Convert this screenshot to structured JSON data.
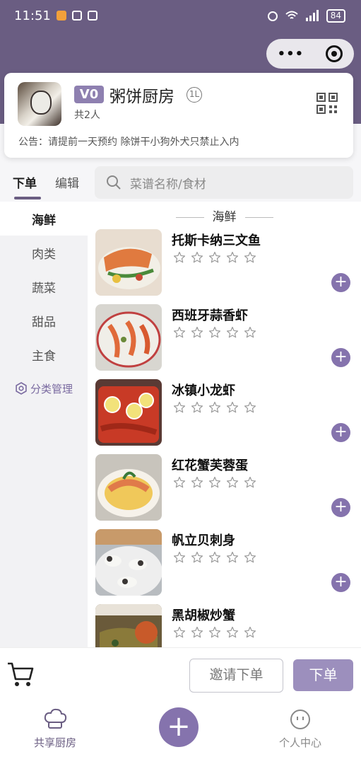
{
  "status_bar": {
    "time": "11:51",
    "battery": "84"
  },
  "capsule": {
    "more_label": "•••"
  },
  "kitchen": {
    "vip_badge": "V0",
    "name": "粥饼厨房",
    "level_badge": "1L",
    "member_count": "共2人",
    "notice": "公告：请提前一天预约 除饼干小狗外犬只禁止入内"
  },
  "tabs": [
    {
      "label": "下单",
      "active": true
    },
    {
      "label": "编辑",
      "active": false
    }
  ],
  "search": {
    "placeholder": "菜谱名称/食材"
  },
  "categories": [
    {
      "label": "海鲜",
      "active": true
    },
    {
      "label": "肉类",
      "active": false
    },
    {
      "label": "蔬菜",
      "active": false
    },
    {
      "label": "甜品",
      "active": false
    },
    {
      "label": "主食",
      "active": false
    }
  ],
  "category_manage": "分类管理",
  "section_title": "海鲜",
  "dishes": [
    {
      "name": "托斯卡纳三文鱼",
      "rating": 0
    },
    {
      "name": "西班牙蒜香虾",
      "rating": 0
    },
    {
      "name": "冰镇小龙虾",
      "rating": 0
    },
    {
      "name": "红花蟹芙蓉蛋",
      "rating": 0
    },
    {
      "name": "帆立贝刺身",
      "rating": 0
    },
    {
      "name": "黑胡椒炒蟹",
      "rating": 0
    }
  ],
  "actions": {
    "invite_label": "邀请下单",
    "order_label": "下单"
  },
  "tabbar": {
    "left_label": "共享厨房",
    "center_label": "+",
    "right_label": "个人中心"
  },
  "colors": {
    "primary": "#6a5d82",
    "accent": "#8573ad",
    "badge": "#8e80b0"
  }
}
